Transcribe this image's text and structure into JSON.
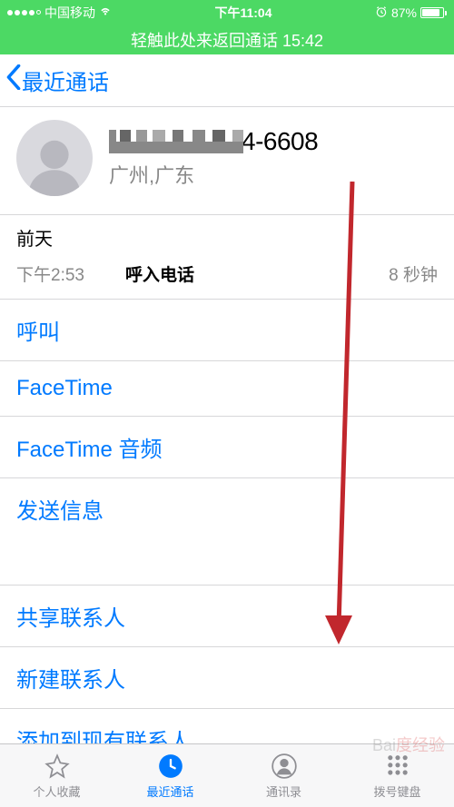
{
  "status": {
    "carrier": "中国移动",
    "time": "下午11:04",
    "battery_pct": "87%"
  },
  "return_banner": "轻触此处来返回通话 15:42",
  "nav": {
    "back_label": "最近通话"
  },
  "contact": {
    "phone_suffix": "4-6608",
    "location": "广州,广东"
  },
  "history": {
    "day_label": "前天",
    "entries": [
      {
        "time": "下午2:53",
        "type": "呼入电话",
        "duration": "8 秒钟"
      }
    ]
  },
  "actions_primary": [
    {
      "id": "call",
      "label": "呼叫"
    },
    {
      "id": "facetime",
      "label": "FaceTime"
    },
    {
      "id": "facetime-audio",
      "label": "FaceTime 音频"
    },
    {
      "id": "send-message",
      "label": "发送信息"
    }
  ],
  "actions_secondary": [
    {
      "id": "share-contact",
      "label": "共享联系人"
    },
    {
      "id": "create-contact",
      "label": "新建联系人"
    },
    {
      "id": "add-to-existing",
      "label": "添加到现有联系人"
    }
  ],
  "tabs": {
    "favorites": "个人收藏",
    "recents": "最近通话",
    "contacts": "通讯录",
    "keypad": "拨号键盘"
  },
  "watermark": "Bai",
  "watermark2": "度经验"
}
